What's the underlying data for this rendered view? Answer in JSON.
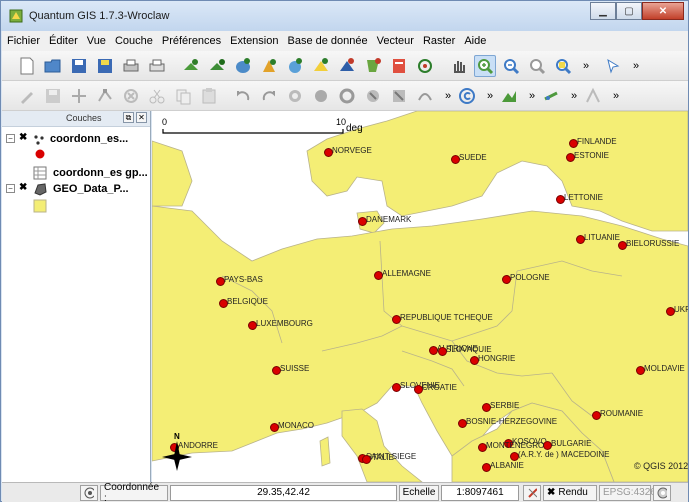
{
  "window": {
    "title": "Quantum GIS 1.7.3-Wroclaw"
  },
  "menu": [
    "Fichier",
    "Éditer",
    "Vue",
    "Couche",
    "Préférences",
    "Extension",
    "Base de donnée",
    "Vecteur",
    "Raster",
    "Aide"
  ],
  "toolbar_overflow": "»",
  "layers_panel": {
    "title": "Couches",
    "layers": [
      {
        "label": "coordonn_es...",
        "checked": true,
        "symbol": "point-layer-icon"
      },
      {
        "label": "coordonn_es gp...",
        "checked": false,
        "symbol": "table-layer-icon"
      },
      {
        "label": "GEO_Data_P...",
        "checked": true,
        "symbol": "polygon-layer-icon"
      }
    ]
  },
  "map": {
    "scale": {
      "start": "0",
      "end": "10",
      "unit": "degrés"
    },
    "copyright": "© QGIS 2012",
    "north_label": "N",
    "colors": {
      "land": "#f4ee75",
      "sea": "#ffffff",
      "border": "#b9b38a",
      "point": "#d90000"
    },
    "cities": [
      "FINLANDE",
      "ESTONIE",
      "NORVEGE",
      "SUEDE",
      "LETTONIE",
      "DANEMARK",
      "LITUANIE",
      "BIELORUSSIE",
      "PAYS-BAS",
      "ALLEMAGNE",
      "POLOGNE",
      "BELGIQUE",
      "LUXEMBOURG",
      "REPUBLIQUE TCHEQUE",
      "UKR",
      "AUTRICHE",
      "SLOVAQUIE",
      "HONGRIE",
      "SUISSE",
      "MOLDAVIE",
      "SLOVENIE",
      "CROATIE",
      "SERBIE",
      "ROUMANIE",
      "BOSNIE-HERZEGOVINE",
      "MONACO",
      "KOSOVO",
      "BULGARIE",
      "MONTENEGRO",
      "(A.R.Y. de ) MACEDOINE",
      "ANDORRE",
      "SAINT-SIEGE",
      "ITALIE",
      "ALBANIE"
    ]
  },
  "status": {
    "coord_label": "Coordonnée :",
    "coord_value": "29.35,42.42",
    "scale_label": "Echelle",
    "scale_value": "1:8097461",
    "render_label": "Rendu",
    "crs": "EPSG:4326"
  }
}
